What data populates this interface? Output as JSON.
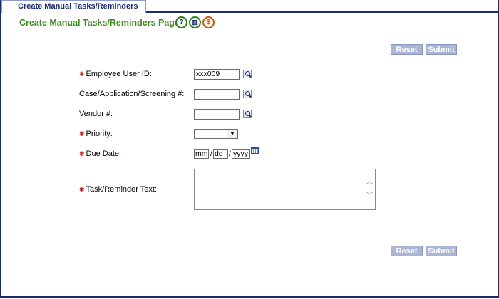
{
  "tab": {
    "label": "Create Manual Tasks/Reminders"
  },
  "page": {
    "title": "Create Manual Tasks/Reminders Page",
    "icons": [
      "help-icon",
      "book-icon",
      "dollar-icon"
    ]
  },
  "buttons": {
    "reset": "Reset",
    "submit": "Submit"
  },
  "form": {
    "employee_user_id": {
      "label": "Employee User ID:",
      "value": "xxx009",
      "required": true
    },
    "case_number": {
      "label": "Case/Application/Screening #:",
      "value": "",
      "required": false
    },
    "vendor_number": {
      "label": "Vendor #:",
      "value": "",
      "required": false
    },
    "priority": {
      "label": "Priority:",
      "value": "",
      "required": true
    },
    "due_date": {
      "label": "Due Date:",
      "month": "mm",
      "day": "dd",
      "year": "yyyy",
      "sep": "/",
      "required": true
    },
    "task_text": {
      "label": "Task/Reminder Text:",
      "value": "",
      "required": true
    }
  },
  "colors": {
    "title_green": "#3f8c1e",
    "tab_navy": "#1c2a6e",
    "button_blue": "#aab4d4",
    "required_red": "#c9242a"
  }
}
